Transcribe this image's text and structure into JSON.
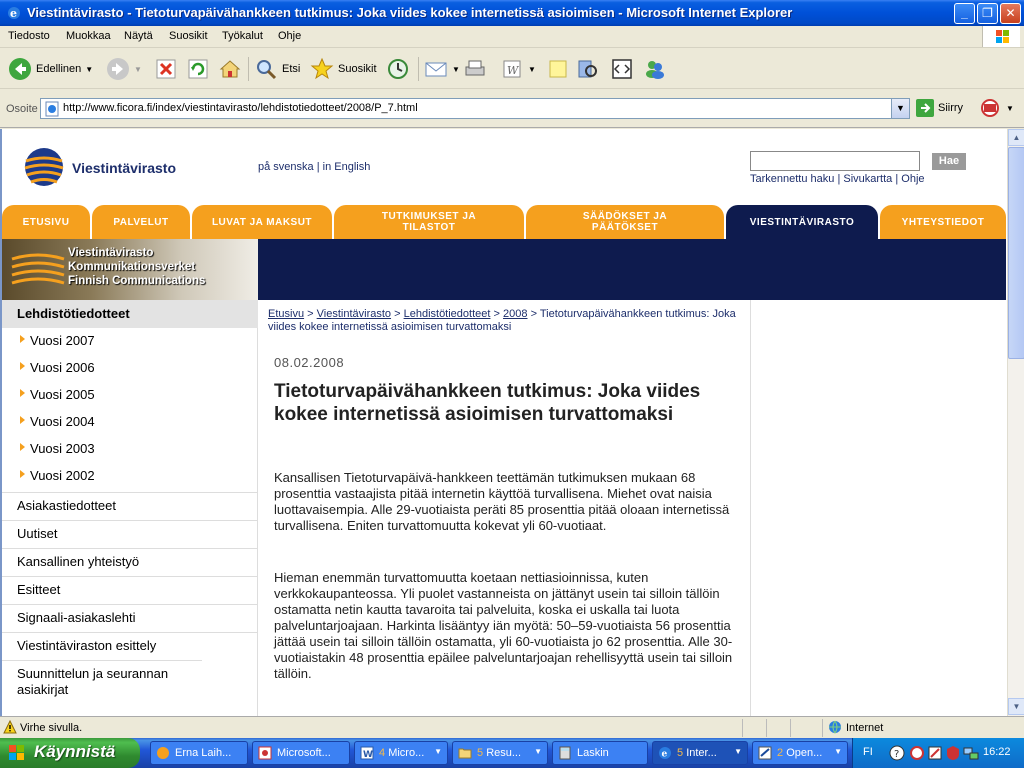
{
  "window": {
    "title": "Viestintävirasto - Tietoturvapäivähankkeen tutkimus: Joka viides kokee internetissä asioimisen  - Microsoft Internet Explorer"
  },
  "menu": [
    "Tiedosto",
    "Muokkaa",
    "Näytä",
    "Suosikit",
    "Työkalut",
    "Ohje"
  ],
  "toolbar": {
    "back_label": "Edellinen",
    "search_label": "Etsi",
    "favorites_label": "Suosikit"
  },
  "address": {
    "label": "Osoite",
    "url": "http://www.ficora.fi/index/viestintavirasto/lehdistotiedotteet/2008/P_7.html",
    "go_label": "Siirry"
  },
  "site": {
    "name": "Viestintävirasto",
    "lang_sv": "på svenska",
    "lang_sep": "|",
    "lang_en": "in English",
    "search_button": "Hae",
    "advanced_search": "Tarkennettu haku",
    "sitemap": "Sivukartta",
    "help": "Ohje",
    "link_sep": "|"
  },
  "nav_tabs": [
    {
      "label": "ETUSIVU"
    },
    {
      "label": "PALVELUT"
    },
    {
      "label": "LUVAT JA MAKSUT"
    },
    {
      "label": "TUTKIMUKSET JA TILASTOT"
    },
    {
      "label": "SÄÄDÖKSET JA PÄÄTÖKSET"
    },
    {
      "label": "VIESTINTÄVIRASTO"
    },
    {
      "label": "YHTEYSTIEDOT"
    }
  ],
  "banner": {
    "line1": "Viestintävirasto",
    "line2": "Kommunikationsverket",
    "line3": "Finnish Communications"
  },
  "leftnav": {
    "header": "Lehdistötiedotteet",
    "years": [
      "Vuosi 2007",
      "Vuosi 2006",
      "Vuosi 2005",
      "Vuosi 2004",
      "Vuosi 2003",
      "Vuosi 2002"
    ],
    "items": [
      "Asiakastiedotteet",
      "Uutiset",
      "Kansallinen yhteistyö",
      "Esitteet",
      "Signaali-asiakaslehti",
      "Viestintäviraston esittely",
      "Suunnittelun ja seurannan asiakirjat"
    ]
  },
  "breadcrumb": {
    "home": "Etusivu",
    "sep": ">",
    "l1": "Viestintävirasto",
    "l2": "Lehdistötiedotteet",
    "l3": "2008",
    "current": "Tietoturvapäivähankkeen tutkimus: Joka viides kokee internetissä asioimisen turvattomaksi"
  },
  "article": {
    "date": "08.02.2008",
    "title": "Tietoturvapäivähankkeen tutkimus: Joka viides kokee internetissä asioimisen turvattomaksi",
    "p1": "Kansallisen Tietoturvapäivä-hankkeen teettämän tutkimuksen mukaan 68 prosenttia vastaajista pitää internetin käyttöä turvallisena. Miehet ovat naisia luottavaisempia. Alle 29-vuotiaista peräti 85 prosenttia pitää oloaan internetissä turvallisena. Eniten turvattomuutta kokevat yli 60-vuotiaat.",
    "p2": "Hieman enemmän turvattomuutta koetaan nettiasioinnissa, kuten verkkokaupanteossa. Yli puolet vastanneista on jättänyt usein tai silloin tällöin ostamatta netin kautta tavaroita tai palveluita, koska ei uskalla tai luota palveluntarjoajaan. Harkinta lisääntyy iän myötä: 50–59-vuotiaista 56 prosenttia jättää usein tai silloin tällöin ostamatta, yli 60-vuotiaista jo 62 prosenttia. Alle 30-vuotiaistakin 48 prosenttia epäilee palveluntarjoajan rehellisyyttä usein tai silloin tällöin."
  },
  "status": {
    "message": "Virhe sivulla.",
    "zone": "Internet"
  },
  "taskbar": {
    "start": "Käynnistä",
    "tasks": [
      {
        "count": "",
        "label": "Erna Laih..."
      },
      {
        "count": "",
        "label": "Microsoft..."
      },
      {
        "count": "4",
        "label": "Micro..."
      },
      {
        "count": "5",
        "label": "Resu..."
      },
      {
        "count": "",
        "label": "Laskin"
      },
      {
        "count": "5",
        "label": "Inter..."
      },
      {
        "count": "2",
        "label": "Open..."
      }
    ],
    "lang": "FI",
    "clock": "16:22"
  }
}
